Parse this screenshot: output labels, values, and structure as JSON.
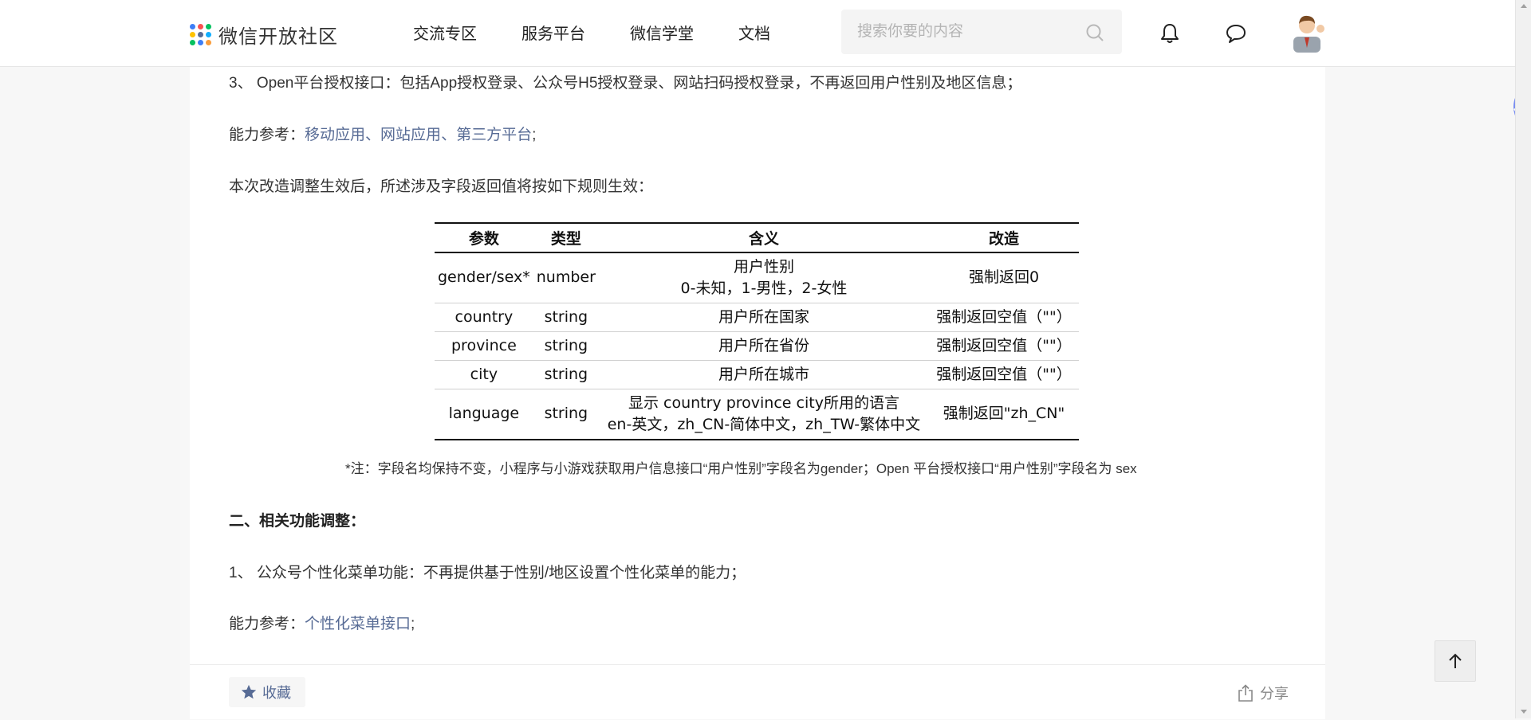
{
  "header": {
    "logo_text": "微信开放社区",
    "nav": [
      "交流专区",
      "服务平台",
      "微信学堂",
      "文档"
    ],
    "search_placeholder": "搜索你要的内容"
  },
  "article": {
    "p1": "3、 Open平台授权接口：包括App授权登录、公众号H5授权登录、网站扫码授权登录，不再返回用户性别及地区信息；",
    "ref1_prefix": "能力参考：",
    "ref1_link1": "移动应用",
    "ref1_sep1": "、",
    "ref1_link2": "网站应用",
    "ref1_sep2": "、",
    "ref1_link3": "第三方平台",
    "ref1_suffix": ";",
    "p2": "本次改造调整生效后，所述涉及字段返回值将按如下规则生效：",
    "table": {
      "headers": [
        "参数",
        "类型",
        "含义",
        "改造"
      ],
      "rows": [
        {
          "param": "gender/sex*",
          "type": "number",
          "meaning1": "用户性别",
          "meaning2": "0-未知，1-男性，2-女性",
          "change": "强制返回0"
        },
        {
          "param": "country",
          "type": "string",
          "meaning1": "用户所在国家",
          "meaning2": "",
          "change": "强制返回空值（\"\"）"
        },
        {
          "param": "province",
          "type": "string",
          "meaning1": "用户所在省份",
          "meaning2": "",
          "change": "强制返回空值（\"\"）"
        },
        {
          "param": "city",
          "type": "string",
          "meaning1": "用户所在城市",
          "meaning2": "",
          "change": "强制返回空值（\"\"）"
        },
        {
          "param": "language",
          "type": "string",
          "meaning1": "显示 country province city所用的语言",
          "meaning2": "en-英文，zh_CN-简体中文，zh_TW-繁体中文",
          "change": "强制返回\"zh_CN\""
        }
      ]
    },
    "note": "*注：字段名均保持不变，小程序与小游戏获取用户信息接口“用户性别”字段名为gender；Open 平台授权接口“用户性别”字段名为 sex",
    "h2": "二、相关功能调整：",
    "p3": "1、 公众号个性化菜单功能：不再提供基于性别/地区设置个性化菜单的能力；",
    "ref2_prefix": "能力参考：",
    "ref2_link": "个性化菜单接口",
    "ref2_suffix": ";"
  },
  "footer": {
    "fav_label": "收藏",
    "share_label": "分享"
  },
  "icons": {
    "search": "search-icon",
    "bell": "bell-icon",
    "message": "message-icon",
    "star": "star-icon",
    "share": "share-icon",
    "arrow_up": "arrow-up-icon"
  },
  "colors": {
    "link": "#576b95",
    "page_bg": "#f7f7f7"
  }
}
